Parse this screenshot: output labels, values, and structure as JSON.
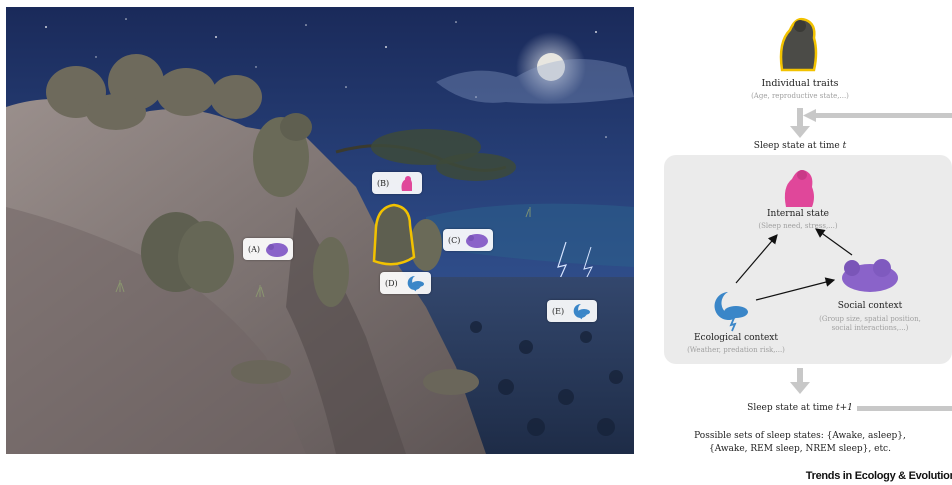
{
  "scene_tags": [
    {
      "letter": "(A)",
      "icon": "social-icon"
    },
    {
      "letter": "(B)",
      "icon": "internal-icon"
    },
    {
      "letter": "(C)",
      "icon": "social-icon"
    },
    {
      "letter": "(D)",
      "icon": "ecological-icon"
    },
    {
      "letter": "(E)",
      "icon": "ecological-icon"
    }
  ],
  "diagram": {
    "individual_title": "Individual traits",
    "individual_sub": "(Age, reproductive state,...)",
    "sleep_t_prefix": "Sleep state at time ",
    "sleep_t_var": "t",
    "internal_title": "Internal state",
    "internal_sub": "(Sleep need, stress,...)",
    "social_title": "Social context",
    "social_sub_1": "(Group size, spatial position,",
    "social_sub_2": "social interactions,...)",
    "eco_title": "Ecological context",
    "eco_sub": "(Weather, predation risk,...)",
    "sleep_t1_prefix": "Sleep state at time ",
    "sleep_t1_var": "t+1",
    "possible_1": "Possible sets of sleep states: {Awake, asleep},",
    "possible_2": "{Awake, REM sleep, NREM sleep}, etc."
  },
  "colors": {
    "internal": "#e0479a",
    "social": "#8a63c9",
    "ecological": "#3a86c8",
    "highlight": "#f2c200",
    "arrow": "#c8c8c8"
  },
  "footer": "Trends in Ecology & Evolution"
}
